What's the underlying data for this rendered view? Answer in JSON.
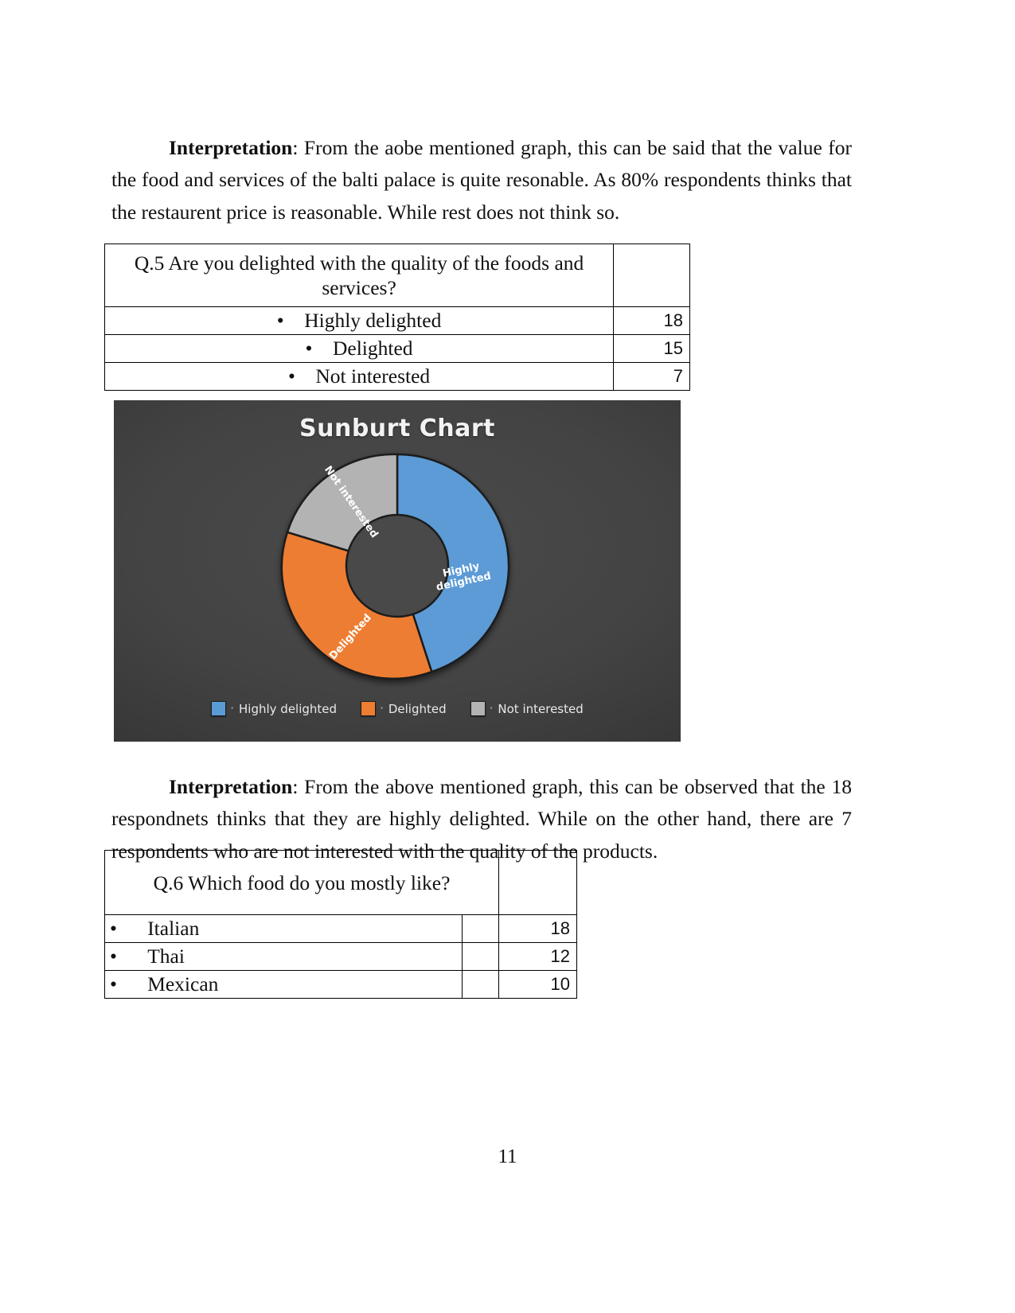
{
  "document": {
    "page_number": "11"
  },
  "paragraphs": [
    {
      "id": "interpretation-1",
      "lead": "Interpretation",
      "body": ": From the aobe mentioned graph, this can be said that the value for the food and services of the balti palace is quite resonable. As 80% respondents thinks that the restaurent price is reasonable. While rest does not think so."
    },
    {
      "id": "interpretation-2",
      "lead": "Interpretation",
      "body": ": From the above mentioned graph, this can be observed that the 18 respondnets thinks that they are highly delighted. While on the other hand, there are 7 respondents who are not interested with the quality of the products."
    }
  ],
  "table_q5": {
    "question": "Q.5 Are you delighted with the quality of the foods and services?",
    "header_value": "",
    "bullet": "•",
    "rows": [
      {
        "label": "Highly delighted",
        "value": "18"
      },
      {
        "label": "Delighted",
        "value": "15"
      },
      {
        "label": "Not interested",
        "value": "7"
      }
    ]
  },
  "table_q6": {
    "question": "Q.6 Which food do you mostly like?",
    "header_value": "",
    "bullet": "•",
    "rows": [
      {
        "label": "Italian",
        "mid": "",
        "value": "18"
      },
      {
        "label": "Thai",
        "mid": "",
        "value": "12"
      },
      {
        "label": "Mexican",
        "mid": "",
        "value": "10"
      }
    ]
  },
  "chart_data": {
    "type": "pie",
    "variant": "donut",
    "title": "Sunburt Chart",
    "categories": [
      "Highly delighted",
      "Delighted",
      "Not interested"
    ],
    "values": [
      18,
      15,
      7
    ],
    "colors": [
      "#5b9bd5",
      "#ed7d31",
      "#b3b3b3"
    ],
    "slice_labels": [
      "Highly delighted",
      "Delighted",
      "Not interested"
    ],
    "legend": {
      "position": "bottom",
      "entries": [
        {
          "label": "Highly delighted",
          "color": "#5b9bd5",
          "marker": "·"
        },
        {
          "label": "Delighted",
          "color": "#ed7d31",
          "marker": "·"
        },
        {
          "label": "Not interested",
          "color": "#b3b3b3",
          "marker": "·"
        }
      ]
    },
    "background": "#3d3d3d",
    "title_color": "#f2f2f2",
    "grid": false,
    "xlabel": "",
    "ylabel": ""
  }
}
